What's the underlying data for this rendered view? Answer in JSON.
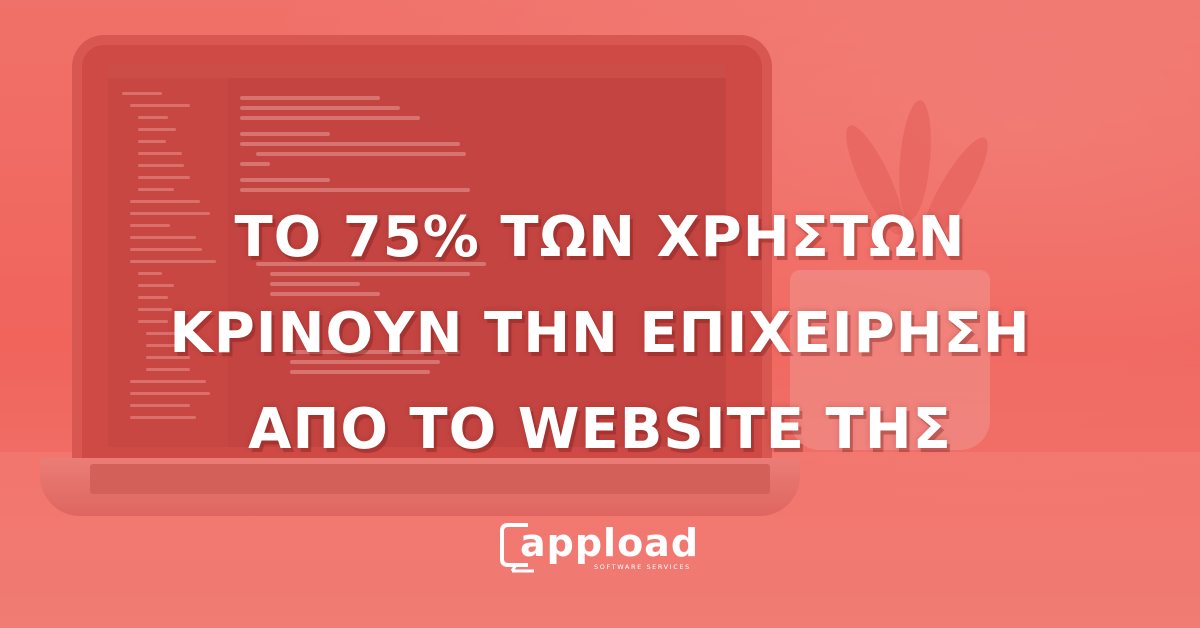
{
  "headline": {
    "line1": "ΤΟ 75% ΤΩΝ ΧΡΗΣΤΩΝ",
    "line2": "ΚΡΙΝΟΥΝ ΤΗΝ ΕΠΙΧΕΙΡΗΣΗ",
    "line3": "ΑΠΟ ΤΟ WEBSITE ΤΗΣ"
  },
  "logo": {
    "name": "appload",
    "tagline": "SOFTWARE SERVICES"
  },
  "colors": {
    "background": "#f26a63",
    "text": "#ffffff"
  },
  "icons": [
    "laptop-illustration",
    "plant-illustration",
    "appload-logo-icon"
  ]
}
